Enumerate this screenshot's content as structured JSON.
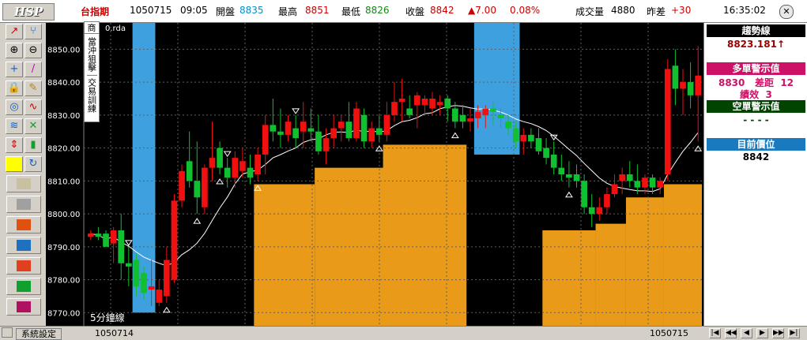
{
  "header": {
    "logo": "HSP",
    "symbol": "台指期",
    "date": "1050715",
    "time": "09:05",
    "open_label": "開盤",
    "open_value": "8835",
    "high_label": "最高",
    "high_value": "8851",
    "low_label": "最低",
    "low_value": "8826",
    "close_label": "收盤",
    "close_value": "8842",
    "change": "▲7.00",
    "change_pct": "0.08%",
    "volume_label": "成交量",
    "volume_value": "4880",
    "diff_label": "昨差",
    "diff_value": "+30",
    "clock": "16:35:02",
    "close_icon": "✕"
  },
  "toolbar": {
    "icons": [
      "trend-line-icon",
      "fork-icon",
      "zoom-in-icon",
      "zoom-out-icon",
      "cross-icon",
      "slash-icon",
      "lock-icon",
      "pencil-icon",
      "target-icon",
      "curve-icon",
      "wave-icon",
      "crossing-icon",
      "updown-icon",
      "candles-icon",
      "color-swatch-icon",
      "refresh-icon",
      "folder-icon",
      "scissors-icon",
      "stop-icon",
      "monitor-icon",
      "grid-icon",
      "gloves-icon",
      "burst-icon"
    ]
  },
  "overlay": {
    "vertical_tabs": [
      "商",
      "當沖狙擊",
      "交易訓練"
    ],
    "file_label": "0.rda",
    "period_label": "5分鐘線"
  },
  "sidepanel": {
    "trend_title": "趨勢線",
    "trend_value": "8823.181↑",
    "long_title": "多單警示值",
    "long_value": "8830",
    "long_diff_label": "差距",
    "long_diff_value": "12",
    "long_perf_label": "績效",
    "long_perf_value": "3",
    "short_title": "空單警示值",
    "short_value": "- - - -",
    "current_title": "目前價位",
    "current_value": "8842"
  },
  "footer": {
    "settings_label": "系統設定",
    "left_date": "1050714",
    "right_date": "1050715",
    "nav_buttons": [
      "|◀",
      "◀◀",
      "◀",
      "▶",
      "▶▶",
      "▶|"
    ]
  },
  "colors": {
    "up": "#f01010",
    "down": "#10c030",
    "band": "#e89a18",
    "warning": "#3fa0e0",
    "trend_title_bg": "#000000",
    "long_bg": "#cc1166",
    "short_bg": "#004400",
    "current_bg": "#1a7abf"
  },
  "chart_data": {
    "type": "candlestick",
    "ylim": [
      8766,
      8858
    ],
    "yticks": [
      8770,
      8780,
      8790,
      8800,
      8810,
      8820,
      8830,
      8840,
      8850
    ],
    "ylabels": [
      "8770.00",
      "8780.00",
      "8790.00",
      "8800.00",
      "8810.00",
      "8820.00",
      "8830.00",
      "8840.00",
      "8850.00"
    ],
    "grid": true,
    "candles": [
      [
        8793,
        8795,
        8792,
        8794
      ],
      [
        8794,
        8796,
        8792,
        8793
      ],
      [
        8794,
        8795,
        8790,
        8790
      ],
      [
        8791,
        8796,
        8785,
        8795
      ],
      [
        8795,
        8800,
        8780,
        8785
      ],
      [
        8785,
        8790,
        8778,
        8784
      ],
      [
        8786,
        8788,
        8775,
        8778
      ],
      [
        8782,
        8784,
        8774,
        8776
      ],
      [
        8777,
        8786,
        8772,
        8778
      ],
      [
        8773,
        8780,
        8772,
        8777
      ],
      [
        8775,
        8790,
        8773,
        8786
      ],
      [
        8780,
        8806,
        8779,
        8804
      ],
      [
        8804,
        8815,
        8802,
        8813
      ],
      [
        8816,
        8825,
        8808,
        8810
      ],
      [
        8810,
        8822,
        8800,
        8805
      ],
      [
        8802,
        8815,
        8800,
        8814
      ],
      [
        8814,
        8828,
        8810,
        8817
      ],
      [
        8820,
        8822,
        8812,
        8814
      ],
      [
        8814,
        8817,
        8808,
        8811
      ],
      [
        8811,
        8819,
        8808,
        8817
      ],
      [
        8813,
        8820,
        8811,
        8816
      ],
      [
        8814,
        8818,
        8809,
        8811
      ],
      [
        8812,
        8820,
        8810,
        8818
      ],
      [
        8818,
        8830,
        8812,
        8827
      ],
      [
        8827,
        8835,
        8822,
        8825
      ],
      [
        8825,
        8832,
        8820,
        8824
      ],
      [
        8824,
        8830,
        8822,
        8828
      ],
      [
        8826,
        8830,
        8820,
        8823
      ],
      [
        8825,
        8834,
        8820,
        8828
      ],
      [
        8826,
        8832,
        8822,
        8825
      ],
      [
        8825,
        8830,
        8818,
        8819
      ],
      [
        8819,
        8826,
        8815,
        8823
      ],
      [
        8823,
        8830,
        8820,
        8826
      ],
      [
        8826,
        8830,
        8822,
        8828
      ],
      [
        8828,
        8834,
        8822,
        8823
      ],
      [
        8823,
        8834,
        8822,
        8832
      ],
      [
        8830,
        8832,
        8820,
        8822
      ],
      [
        8822,
        8828,
        8820,
        8826
      ],
      [
        8826,
        8830,
        8822,
        8824
      ],
      [
        8824,
        8834,
        8822,
        8830
      ],
      [
        8830,
        8840,
        8828,
        8834
      ],
      [
        8834,
        8841,
        8828,
        8835
      ],
      [
        8832,
        8836,
        8829,
        8830
      ],
      [
        8833,
        8837,
        8826,
        8836
      ],
      [
        8833,
        8836,
        8830,
        8835
      ],
      [
        8832,
        8837,
        8830,
        8835
      ],
      [
        8833,
        8836,
        8830,
        8834
      ],
      [
        8835,
        8836,
        8828,
        8832
      ],
      [
        8832,
        8834,
        8826,
        8828
      ],
      [
        8830,
        8833,
        8826,
        8828
      ],
      [
        8828,
        8832,
        8825,
        8829
      ],
      [
        8829,
        8833,
        8826,
        8831
      ],
      [
        8830,
        8833,
        8826,
        8832
      ],
      [
        8832,
        8834,
        8827,
        8831
      ],
      [
        8830,
        8832,
        8826,
        8829
      ],
      [
        8828,
        8830,
        8824,
        8826
      ],
      [
        8826,
        8828,
        8820,
        8822
      ],
      [
        8822,
        8826,
        8818,
        8824
      ],
      [
        8824,
        8826,
        8820,
        8822
      ],
      [
        8823,
        8826,
        8818,
        8819
      ],
      [
        8820,
        8823,
        8815,
        8817
      ],
      [
        8818,
        8822,
        8812,
        8814
      ],
      [
        8814,
        8818,
        8810,
        8812
      ],
      [
        8812,
        8816,
        8808,
        8811
      ],
      [
        8812,
        8815,
        8808,
        8810
      ],
      [
        8810,
        8812,
        8800,
        8802
      ],
      [
        8802,
        8806,
        8796,
        8800
      ],
      [
        8800,
        8805,
        8798,
        8802
      ],
      [
        8802,
        8808,
        8800,
        8806
      ],
      [
        8806,
        8812,
        8805,
        8809
      ],
      [
        8810,
        8814,
        8806,
        8812
      ],
      [
        8812,
        8816,
        8808,
        8810
      ],
      [
        8810,
        8815,
        8806,
        8808
      ],
      [
        8808,
        8812,
        8806,
        8811
      ],
      [
        8811,
        8812,
        8806,
        8808
      ],
      [
        8808,
        8811,
        8806,
        8810
      ],
      [
        8812,
        8847,
        8810,
        8844
      ],
      [
        8845,
        8850,
        8833,
        8838
      ],
      [
        8838,
        8844,
        8830,
        8840
      ],
      [
        8840,
        8846,
        8832,
        8836
      ],
      [
        8836,
        8851,
        8822,
        8842
      ]
    ]
  }
}
